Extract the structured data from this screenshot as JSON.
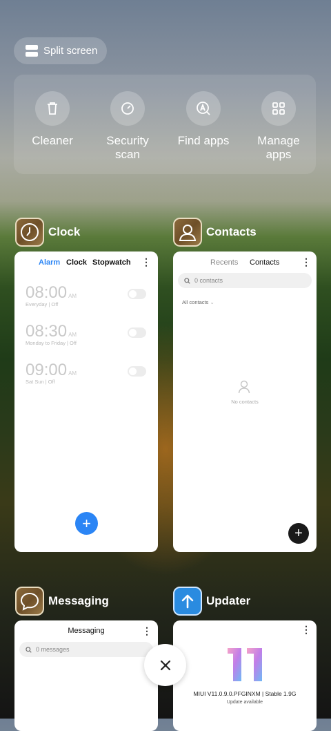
{
  "split_screen": {
    "label": "Split screen"
  },
  "quick_actions": [
    {
      "label": "Cleaner",
      "icon": "trash-icon"
    },
    {
      "label": "Security\nscan",
      "icon": "security-scan-icon"
    },
    {
      "label": "Find apps",
      "icon": "find-apps-icon"
    },
    {
      "label": "Manage\napps",
      "icon": "grid-icon"
    }
  ],
  "apps": {
    "clock": {
      "name": "Clock",
      "tabs": [
        "Alarm",
        "Clock",
        "Stopwatch"
      ],
      "active_tab_color": "#2b85f5",
      "alarms": [
        {
          "time": "08:00",
          "ampm": "AM",
          "repeat": "Everyday  |  Off"
        },
        {
          "time": "08:30",
          "ampm": "AM",
          "repeat": "Monday to Friday  |  Off"
        },
        {
          "time": "09:00",
          "ampm": "AM",
          "repeat": "Sat Sun  |  Off"
        }
      ],
      "fab": "+"
    },
    "contacts": {
      "name": "Contacts",
      "tabs": [
        "Recents",
        "Contacts"
      ],
      "search_placeholder": "0 contacts",
      "filter_label": "All contacts",
      "empty_text": "No contacts",
      "fab": "+"
    },
    "messaging": {
      "name": "Messaging",
      "title": "Messaging",
      "search_placeholder": "0 messages"
    },
    "updater": {
      "name": "Updater",
      "version_text": "MIUI V11.0.9.0.PFGINXM | Stable 1.9G",
      "status_text": "Update available"
    }
  },
  "colors": {
    "accent_blue": "#2b85f5",
    "dark_fab": "#1a1a1a"
  }
}
